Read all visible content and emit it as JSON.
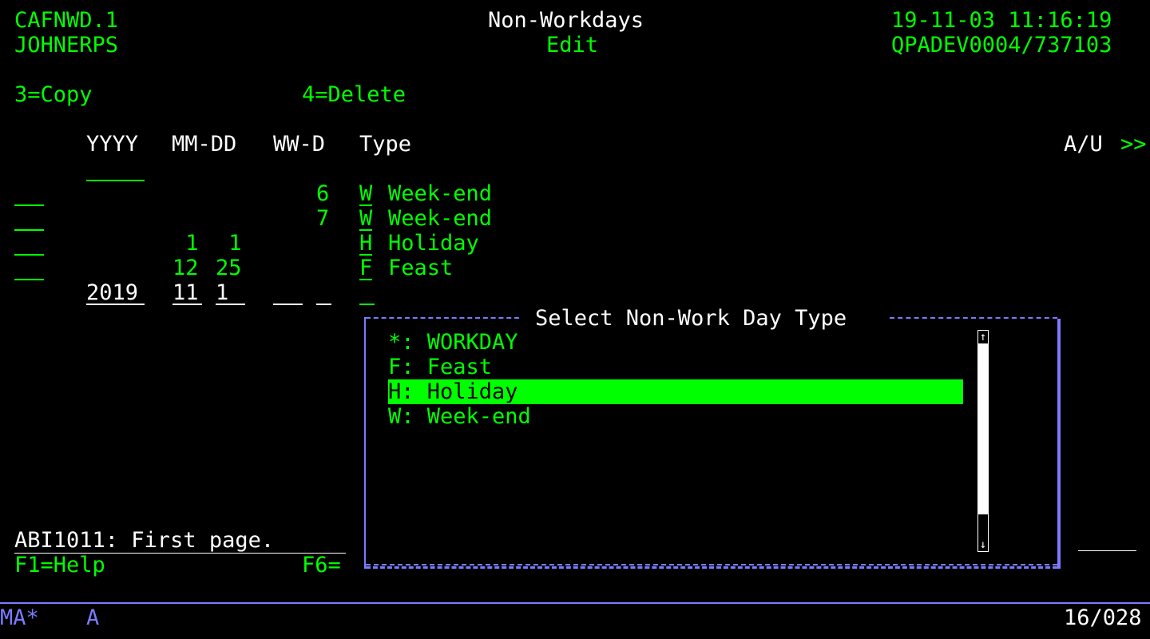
{
  "header": {
    "program": "CAFNWD.1",
    "user": "JOHNERPS",
    "title": "Non-Workdays",
    "mode": "Edit",
    "datetime": "19-11-03 11:16:19",
    "device": "QPADEV0004/737103"
  },
  "options": {
    "copy": "3=Copy",
    "delete": "4=Delete"
  },
  "columns": {
    "year": "YYYY",
    "month_day": "MM-DD",
    "week_day": "WW-D",
    "type": "Type",
    "au": "A/U",
    "more": ">>"
  },
  "rows": [
    {
      "year": "",
      "month": "",
      "day": "",
      "weekday": "6",
      "type_code": "W",
      "type_desc": "Week-end"
    },
    {
      "year": "",
      "month": "",
      "day": "",
      "weekday": "7",
      "type_code": "W",
      "type_desc": "Week-end"
    },
    {
      "year": "",
      "month": " 1",
      "day": " 1",
      "weekday": "",
      "type_code": "H",
      "type_desc": "Holiday"
    },
    {
      "year": "",
      "month": "12",
      "day": "25",
      "weekday": "",
      "type_code": "F",
      "type_desc": "Feast"
    }
  ],
  "entry": {
    "year": "2019",
    "month": "11",
    "day": "1",
    "week": "",
    "weekday": "",
    "type": ""
  },
  "popup": {
    "title": "Select Non-Work Day Type",
    "options": [
      "*: WORKDAY",
      "F: Feast",
      "H: Holiday",
      "W: Week-end"
    ],
    "selected_index": 2,
    "scroll_up": "↑",
    "scroll_down": "↓"
  },
  "message": "ABI1011: First page.",
  "fkeys": {
    "help": "F1=Help",
    "f6": "F6="
  },
  "status_bar": {
    "left": "MA*",
    "mode": "A",
    "cursor": "16/028"
  },
  "colors": {
    "green": "#00ff00",
    "white": "#ffffff",
    "blue": "#7b7bff",
    "background": "#000000"
  }
}
